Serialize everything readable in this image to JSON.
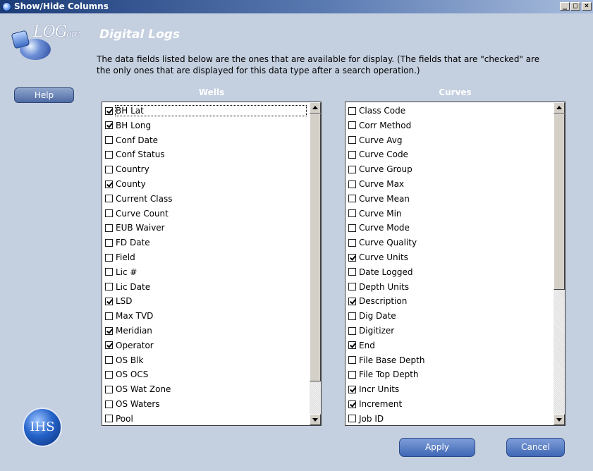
{
  "window": {
    "title": "Show/Hide Columns"
  },
  "brand": {
    "logo_main": "LOG",
    "logo_sub": "arc",
    "ihs_logo": "IHS"
  },
  "sidebar": {
    "help_label": "Help"
  },
  "header": {
    "title": "Digital Logs"
  },
  "description": "The data fields listed below are the ones that are available for display. (The fields that are \"checked\" are the only ones that are displayed for this data type after a search operation.)",
  "wells": {
    "heading": "Wells",
    "items": [
      {
        "label": "BH Lat",
        "checked": true
      },
      {
        "label": "BH Long",
        "checked": true
      },
      {
        "label": "Conf Date",
        "checked": false
      },
      {
        "label": "Conf Status",
        "checked": false
      },
      {
        "label": "Country",
        "checked": false
      },
      {
        "label": "County",
        "checked": true
      },
      {
        "label": "Current Class",
        "checked": false
      },
      {
        "label": "Curve Count",
        "checked": false
      },
      {
        "label": "EUB Waiver",
        "checked": false
      },
      {
        "label": "FD Date",
        "checked": false
      },
      {
        "label": "Field",
        "checked": false
      },
      {
        "label": "Lic #",
        "checked": false
      },
      {
        "label": "Lic Date",
        "checked": false
      },
      {
        "label": "LSD",
        "checked": true
      },
      {
        "label": "Max TVD",
        "checked": false
      },
      {
        "label": "Meridian",
        "checked": true
      },
      {
        "label": "Operator",
        "checked": true
      },
      {
        "label": "OS Blk",
        "checked": false
      },
      {
        "label": "OS OCS",
        "checked": false
      },
      {
        "label": "OS Wat Zone",
        "checked": false
      },
      {
        "label": "OS Waters",
        "checked": false
      },
      {
        "label": "Pool",
        "checked": false
      }
    ]
  },
  "curves": {
    "heading": "Curves",
    "items": [
      {
        "label": "Class Code",
        "checked": false
      },
      {
        "label": "Corr Method",
        "checked": false
      },
      {
        "label": "Curve Avg",
        "checked": false
      },
      {
        "label": "Curve Code",
        "checked": false
      },
      {
        "label": "Curve Group",
        "checked": false
      },
      {
        "label": "Curve Max",
        "checked": false
      },
      {
        "label": "Curve Mean",
        "checked": false
      },
      {
        "label": "Curve Min",
        "checked": false
      },
      {
        "label": "Curve Mode",
        "checked": false
      },
      {
        "label": "Curve Quality",
        "checked": false
      },
      {
        "label": "Curve Units",
        "checked": true
      },
      {
        "label": "Date Logged",
        "checked": false
      },
      {
        "label": "Depth Units",
        "checked": false
      },
      {
        "label": "Description",
        "checked": true
      },
      {
        "label": "Dig Date",
        "checked": false
      },
      {
        "label": "Digitizer",
        "checked": false
      },
      {
        "label": "End",
        "checked": true
      },
      {
        "label": "File Base Depth",
        "checked": false
      },
      {
        "label": "File Top Depth",
        "checked": false
      },
      {
        "label": "Incr Units",
        "checked": true
      },
      {
        "label": "Increment",
        "checked": true
      },
      {
        "label": "Job ID",
        "checked": false
      }
    ]
  },
  "actions": {
    "apply_label": "Apply",
    "cancel_label": "Cancel"
  },
  "colors": {
    "window_bg": "#c4cfdf",
    "titlebar": "#1b3c78",
    "button": "#4e6ba4"
  },
  "icons": [
    "app-globe-icon",
    "minimize-icon",
    "maximize-icon",
    "close-icon",
    "checkbox-icon",
    "scroll-up-icon",
    "scroll-down-icon",
    "ihs-logo-icon",
    "logarc-logo-icon"
  ]
}
